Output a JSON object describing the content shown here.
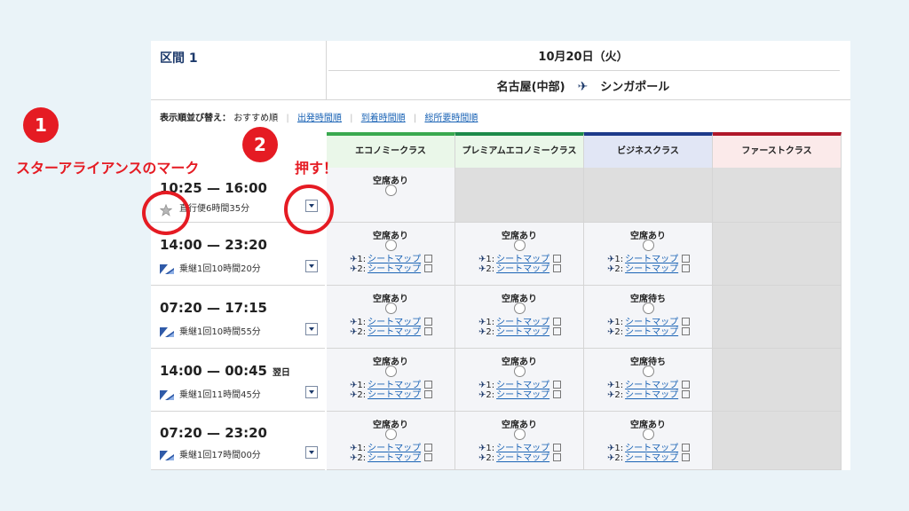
{
  "segment_title": "区間 1",
  "date": "10月20日（火）",
  "route": {
    "origin": "名古屋(中部)",
    "destination": "シンガポール"
  },
  "sort": {
    "label": "表示順並び替え：",
    "current": "おすすめ順",
    "options": [
      "出発時間順",
      "到着時間順",
      "総所要時間順"
    ]
  },
  "classes": [
    {
      "name": "エコノミークラス",
      "accent": "#3aa94f",
      "bg": "#eaf7e9"
    },
    {
      "name": "プレミアムエコノミークラス",
      "accent": "#1c8a4a",
      "bg": "#eaf7e9"
    },
    {
      "name": "ビジネスクラス",
      "accent": "#1d3a8a",
      "bg": "#e1e6f5"
    },
    {
      "name": "ファーストクラス",
      "accent": "#b0182a",
      "bg": "#fbeaea"
    }
  ],
  "seatmap": {
    "leg1": "1:",
    "leg2": "2:",
    "label": "シートマップ"
  },
  "flights": [
    {
      "time": "10:25 — 16:00",
      "next_day": "",
      "duration": "直行便6時間35分",
      "icon": "star-alliance-icon",
      "cells": [
        {
          "status": "空席あり",
          "seatmaps": false
        },
        {
          "status": "",
          "grey": true
        },
        {
          "status": "",
          "grey": true
        },
        {
          "status": "",
          "grey": true
        }
      ]
    },
    {
      "time": "14:00 — 23:20",
      "next_day": "",
      "duration": "乗継1回10時間20分",
      "icon": "airline-logo-icon",
      "cells": [
        {
          "status": "空席あり",
          "seatmaps": true
        },
        {
          "status": "空席あり",
          "seatmaps": true
        },
        {
          "status": "空席あり",
          "seatmaps": true
        },
        {
          "status": "",
          "grey": true
        }
      ]
    },
    {
      "time": "07:20 — 17:15",
      "next_day": "",
      "duration": "乗継1回10時間55分",
      "icon": "airline-logo-icon",
      "cells": [
        {
          "status": "空席あり",
          "seatmaps": true
        },
        {
          "status": "空席あり",
          "seatmaps": true
        },
        {
          "status": "空席待ち",
          "seatmaps": true
        },
        {
          "status": "",
          "grey": true
        }
      ]
    },
    {
      "time": "14:00 — 00:45",
      "next_day": "翌日",
      "duration": "乗継1回11時間45分",
      "icon": "airline-logo-icon",
      "cells": [
        {
          "status": "空席あり",
          "seatmaps": true
        },
        {
          "status": "空席あり",
          "seatmaps": true
        },
        {
          "status": "空席待ち",
          "seatmaps": true
        },
        {
          "status": "",
          "grey": true
        }
      ]
    },
    {
      "time": "07:20 — 23:20",
      "next_day": "",
      "duration": "乗継1回17時間00分",
      "icon": "airline-logo-icon",
      "cells": [
        {
          "status": "空席あり",
          "seatmaps": true
        },
        {
          "status": "空席あり",
          "seatmaps": true
        },
        {
          "status": "空席あり",
          "seatmaps": true
        },
        {
          "status": "",
          "grey": true
        }
      ]
    }
  ],
  "annotations": {
    "badge1": "1",
    "label1": "スターアライアンスのマーク",
    "badge2": "2",
    "label2": "押す！"
  }
}
